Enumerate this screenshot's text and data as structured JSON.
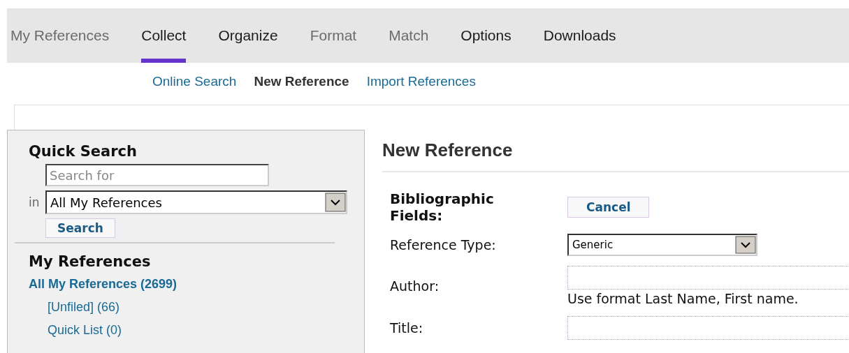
{
  "tabs": [
    {
      "label": "My References",
      "selected": false,
      "disabled": true
    },
    {
      "label": "Collect",
      "selected": true,
      "disabled": false
    },
    {
      "label": "Organize",
      "selected": false,
      "disabled": false
    },
    {
      "label": "Format",
      "selected": false,
      "disabled": true
    },
    {
      "label": "Match",
      "selected": false,
      "disabled": true
    },
    {
      "label": "Options",
      "selected": false,
      "disabled": false
    },
    {
      "label": "Downloads",
      "selected": false,
      "disabled": false
    }
  ],
  "subtabs": [
    {
      "label": "Online Search",
      "selected": false
    },
    {
      "label": "New Reference",
      "selected": true
    },
    {
      "label": "Import References",
      "selected": false
    }
  ],
  "quick_search": {
    "title": "Quick Search",
    "placeholder": "Search for",
    "in_label": "in",
    "scope": "All My References",
    "button": "Search"
  },
  "my_references": {
    "title": "My References",
    "items": [
      {
        "label": "All My References (2699)",
        "selected": true,
        "children": [
          {
            "label": "[Unfiled] (66)",
            "selected": false
          },
          {
            "label": "Quick List (0)",
            "selected": false
          }
        ]
      }
    ]
  },
  "new_reference": {
    "title": "New Reference",
    "section": "Bibliographic Fields:",
    "cancel": "Cancel",
    "fields": [
      {
        "kind": "select",
        "label": "Reference Type:",
        "value": "Generic"
      },
      {
        "kind": "text",
        "label": "Author:",
        "hint": "Use format Last Name, First name."
      },
      {
        "kind": "text",
        "label": "Title:"
      }
    ]
  }
}
